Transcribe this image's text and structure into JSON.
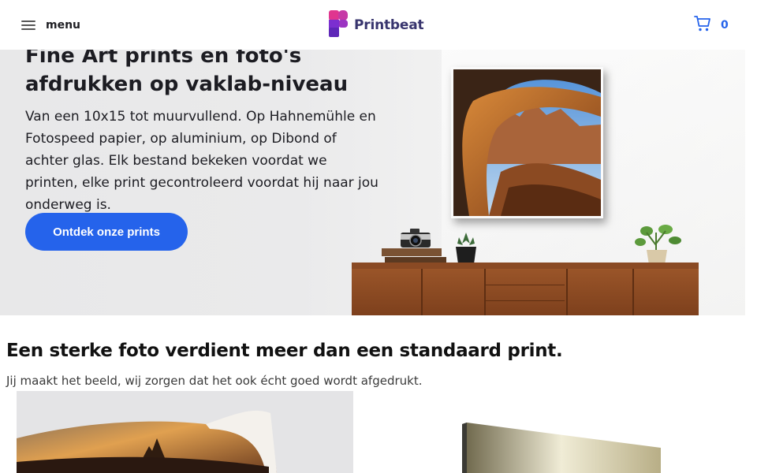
{
  "header": {
    "menu_label": "menu",
    "brand_name": "Printbeat",
    "cart_count": "0"
  },
  "hero": {
    "title": "Fine Art prints en foto's afdrukken op vaklab-niveau",
    "text": "Van een 10x15 tot muurvullend. Op Hahnemühle en Fotospeed papier, op aluminium, op Dibond of achter glas. Elk bestand bekeken voordat we printen, elke print gecontroleerd voordat hij naar jou onderweg is.",
    "cta_label": "Ontdek onze prints"
  },
  "section": {
    "title": "Een sterke foto verdient meer dan een standaard print.",
    "subtitle": "Jij maakt het beeld, wij zorgen dat het ook écht goed wordt afgedrukt."
  },
  "colors": {
    "accent": "#2563eb",
    "brand_purple": "#7b2fd0",
    "brand_pink": "#e0368f",
    "brand_text": "#38356e"
  },
  "icons": {
    "menu": "hamburger-icon",
    "cart": "cart-icon",
    "logo": "printbeat-logo"
  }
}
